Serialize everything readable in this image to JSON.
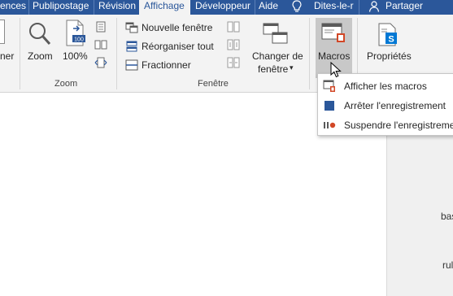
{
  "tabs": [
    {
      "label": "ences",
      "active": false
    },
    {
      "label": "Publipostage",
      "active": false
    },
    {
      "label": "Révision",
      "active": false
    },
    {
      "label": "Affichage",
      "active": true
    },
    {
      "label": "Développeur",
      "active": false
    },
    {
      "label": "Aide",
      "active": false
    },
    {
      "label": "Dites-le-r",
      "active": false
    },
    {
      "label": "Partager",
      "active": false
    }
  ],
  "ribbon": {
    "partial_left_label": "ner",
    "zoom_group": {
      "label": "Zoom",
      "zoom_button": "Zoom",
      "hundred_button": "100%",
      "hundred_icon_text": "100"
    },
    "window_group": {
      "label": "Fenêtre",
      "new_window": "Nouvelle fenêtre",
      "arrange_all": "Réorganiser tout",
      "split": "Fractionner",
      "switch_windows_line1": "Changer de",
      "switch_windows_line2": "fenêtre",
      "dropdown_arrow": "▾"
    },
    "macros_button": "Macros",
    "properties_button": "Propriétés"
  },
  "macros_menu": {
    "items": [
      {
        "label": "Afficher les macros",
        "icon": "view-macros-icon"
      },
      {
        "label": "Arrêter l'enregistrement",
        "icon": "stop-recording-icon"
      },
      {
        "label": "Suspendre l'enregistreme",
        "icon": "pause-recording-icon"
      }
    ]
  },
  "document": {
    "edge_text_1": "bas",
    "edge_text_2": "rul"
  },
  "colors": {
    "title_bar": "#2b579a",
    "ribbon_bg": "#f3f3f3",
    "macros_pressed": "#c8c8c8",
    "record_orange": "#d24726",
    "stop_blue": "#2b579a"
  }
}
